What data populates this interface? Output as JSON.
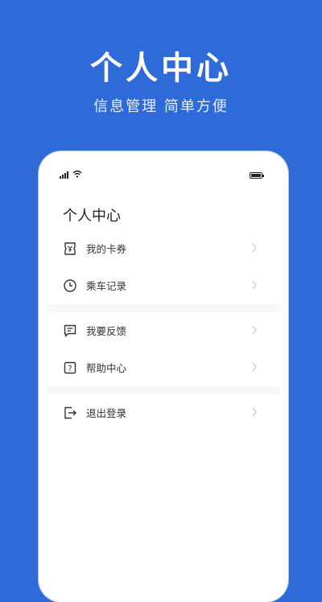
{
  "promo": {
    "title": "个人中心",
    "subtitle": "信息管理 简单方便"
  },
  "screen": {
    "title": "个人中心",
    "groups": [
      {
        "items": [
          {
            "label": "我的卡券",
            "icon": "coupon-icon"
          },
          {
            "label": "乘车记录",
            "icon": "clock-icon"
          }
        ]
      },
      {
        "items": [
          {
            "label": "我要反馈",
            "icon": "feedback-icon"
          },
          {
            "label": "帮助中心",
            "icon": "help-icon"
          }
        ]
      },
      {
        "items": [
          {
            "label": "退出登录",
            "icon": "logout-icon"
          }
        ]
      }
    ]
  },
  "colors": {
    "background": "#2f6bd8",
    "card": "#ffffff",
    "text": "#333333",
    "chevron": "#c8c8c8"
  }
}
